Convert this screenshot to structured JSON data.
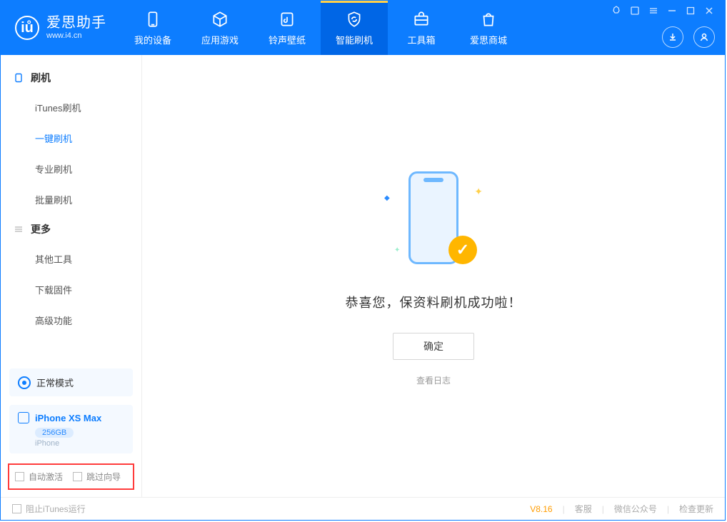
{
  "app": {
    "name": "爱思助手",
    "url": "www.i4.cn"
  },
  "nav": {
    "items": [
      {
        "label": "我的设备"
      },
      {
        "label": "应用游戏"
      },
      {
        "label": "铃声壁纸"
      },
      {
        "label": "智能刷机"
      },
      {
        "label": "工具箱"
      },
      {
        "label": "爱思商城"
      }
    ],
    "active_index": 3
  },
  "sidebar": {
    "group1": {
      "title": "刷机",
      "items": [
        {
          "label": "iTunes刷机"
        },
        {
          "label": "一键刷机"
        },
        {
          "label": "专业刷机"
        },
        {
          "label": "批量刷机"
        }
      ],
      "active_index": 1
    },
    "group2": {
      "title": "更多",
      "items": [
        {
          "label": "其他工具"
        },
        {
          "label": "下载固件"
        },
        {
          "label": "高级功能"
        }
      ]
    },
    "mode": "正常模式",
    "device": {
      "name": "iPhone XS Max",
      "capacity": "256GB",
      "type": "iPhone"
    },
    "options": {
      "auto_activate": "自动激活",
      "skip_guide": "跳过向导"
    }
  },
  "main": {
    "success_message": "恭喜您，保资料刷机成功啦！",
    "ok_button": "确定",
    "view_log": "查看日志"
  },
  "footer": {
    "block_itunes": "阻止iTunes运行",
    "version": "V8.16",
    "links": {
      "support": "客服",
      "wechat": "微信公众号",
      "update": "检查更新"
    }
  }
}
